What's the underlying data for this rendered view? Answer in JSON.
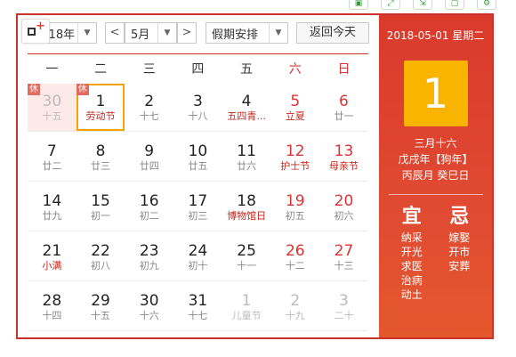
{
  "toolbar_icons": [
    "save-icon",
    "expand-icon",
    "export-icon",
    "restore-icon",
    "settings-icon"
  ],
  "controls": {
    "year_value": "2018年",
    "prev_month_symbol": "<",
    "month_value": "5月",
    "next_month_symbol": ">",
    "holiday_select": "假期安排",
    "today_button": "返回今天"
  },
  "weekdays": [
    "一",
    "二",
    "三",
    "四",
    "五",
    "六",
    "日"
  ],
  "weeks": [
    [
      {
        "day": "30",
        "lunar": "十五",
        "other": true,
        "xiu": "休"
      },
      {
        "day": "1",
        "lunar": "劳动节",
        "festival": true,
        "selected": true,
        "xiu": "休"
      },
      {
        "day": "2",
        "lunar": "十七"
      },
      {
        "day": "3",
        "lunar": "十八"
      },
      {
        "day": "4",
        "lunar": "五四青...",
        "festival": true
      },
      {
        "day": "5",
        "lunar": "立夏",
        "festival": true,
        "weekend": true
      },
      {
        "day": "6",
        "lunar": "廿一",
        "weekend": true
      }
    ],
    [
      {
        "day": "7",
        "lunar": "廿二"
      },
      {
        "day": "8",
        "lunar": "廿三"
      },
      {
        "day": "9",
        "lunar": "廿四"
      },
      {
        "day": "10",
        "lunar": "廿五"
      },
      {
        "day": "11",
        "lunar": "廿六"
      },
      {
        "day": "12",
        "lunar": "护士节",
        "festival": true,
        "weekend": true
      },
      {
        "day": "13",
        "lunar": "母亲节",
        "festival": true,
        "weekend": true
      }
    ],
    [
      {
        "day": "14",
        "lunar": "廿九"
      },
      {
        "day": "15",
        "lunar": "初一"
      },
      {
        "day": "16",
        "lunar": "初二"
      },
      {
        "day": "17",
        "lunar": "初三"
      },
      {
        "day": "18",
        "lunar": "博物馆日",
        "festival": true
      },
      {
        "day": "19",
        "lunar": "初五",
        "weekend": true
      },
      {
        "day": "20",
        "lunar": "初六",
        "weekend": true
      }
    ],
    [
      {
        "day": "21",
        "lunar": "小满",
        "festival": true
      },
      {
        "day": "22",
        "lunar": "初八"
      },
      {
        "day": "23",
        "lunar": "初九"
      },
      {
        "day": "24",
        "lunar": "初十"
      },
      {
        "day": "25",
        "lunar": "十一"
      },
      {
        "day": "26",
        "lunar": "十二",
        "weekend": true
      },
      {
        "day": "27",
        "lunar": "十三",
        "weekend": true
      }
    ],
    [
      {
        "day": "28",
        "lunar": "十四"
      },
      {
        "day": "29",
        "lunar": "十五"
      },
      {
        "day": "30",
        "lunar": "十六"
      },
      {
        "day": "31",
        "lunar": "十七"
      },
      {
        "day": "1",
        "lunar": "儿童节",
        "other": true
      },
      {
        "day": "2",
        "lunar": "十九",
        "other": true
      },
      {
        "day": "3",
        "lunar": "二十",
        "other": true
      }
    ]
  ],
  "right_panel": {
    "date_line": "2018-05-01 星期二",
    "big_day": "1",
    "lunar_date": "三月十六",
    "ganzhi_year": "戊戌年【狗年】",
    "ganzhi_month_day": "丙辰月 癸巳日",
    "yi_title": "宜",
    "ji_title": "忌",
    "yi_items": [
      "纳采",
      "开光",
      "求医",
      "治病",
      "动土"
    ],
    "ji_items": [
      "嫁娶",
      "开市",
      "安葬"
    ]
  },
  "colors": {
    "accent_red": "#c9342a",
    "selected_border": "#f4a400",
    "big_day_bg": "#f9b400",
    "weekend_text": "#d33333",
    "holiday_badge": "#e06b5e"
  }
}
